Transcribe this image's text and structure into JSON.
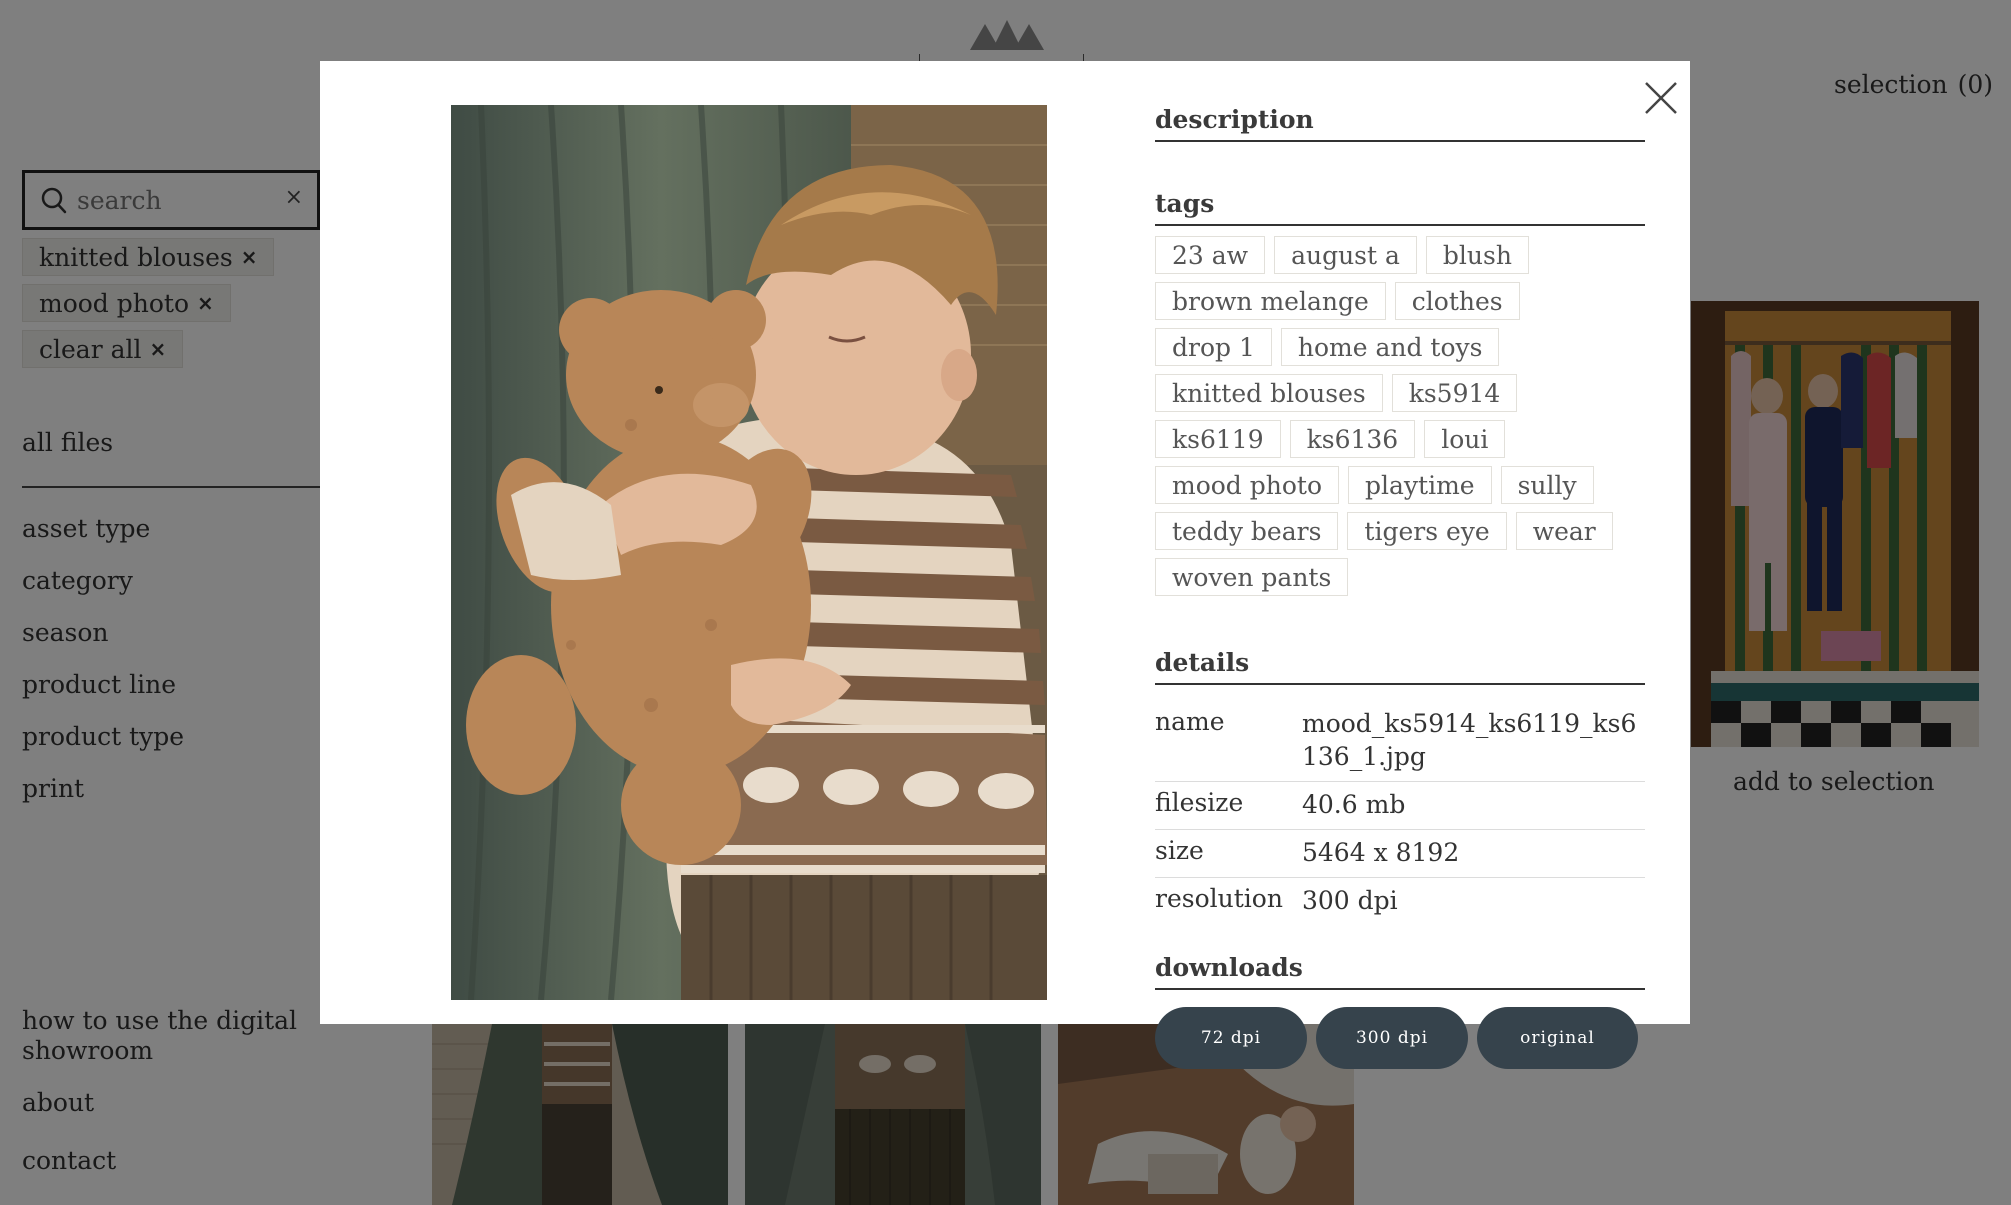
{
  "header": {
    "selection_label": "selection",
    "selection_count": "(0)"
  },
  "search": {
    "placeholder": "search",
    "clear_symbol": "×"
  },
  "active_filters": [
    {
      "label": "knitted blouses",
      "remove": "×"
    },
    {
      "label": "mood photo",
      "remove": "×"
    },
    {
      "label": "clear all",
      "remove": "×"
    }
  ],
  "sidebar": {
    "all_files": "all files",
    "facets": [
      "asset type",
      "category",
      "season",
      "product line",
      "product type",
      "print"
    ],
    "footer_links": [
      "how to use the digital showroom",
      "about",
      "contact"
    ]
  },
  "grid": {
    "add_to_selection": "add to selection"
  },
  "modal": {
    "description_heading": "description",
    "tags_heading": "tags",
    "tags": [
      "23 aw",
      "august a",
      "blush",
      "brown melange",
      "clothes",
      "drop 1",
      "home and toys",
      "knitted blouses",
      "ks5914",
      "ks6119",
      "ks6136",
      "loui",
      "mood photo",
      "playtime",
      "sully",
      "teddy bears",
      "tigers eye",
      "wear",
      "woven pants"
    ],
    "details_heading": "details",
    "details": [
      {
        "key": "name",
        "value": "mood_ks5914_ks6119_ks6136_1.jpg"
      },
      {
        "key": "filesize",
        "value": "40.6 mb"
      },
      {
        "key": "size",
        "value": "5464 x 8192"
      },
      {
        "key": "resolution",
        "value": "300 dpi"
      }
    ],
    "downloads_heading": "downloads",
    "downloads": [
      "72 dpi",
      "300 dpi",
      "original"
    ]
  }
}
